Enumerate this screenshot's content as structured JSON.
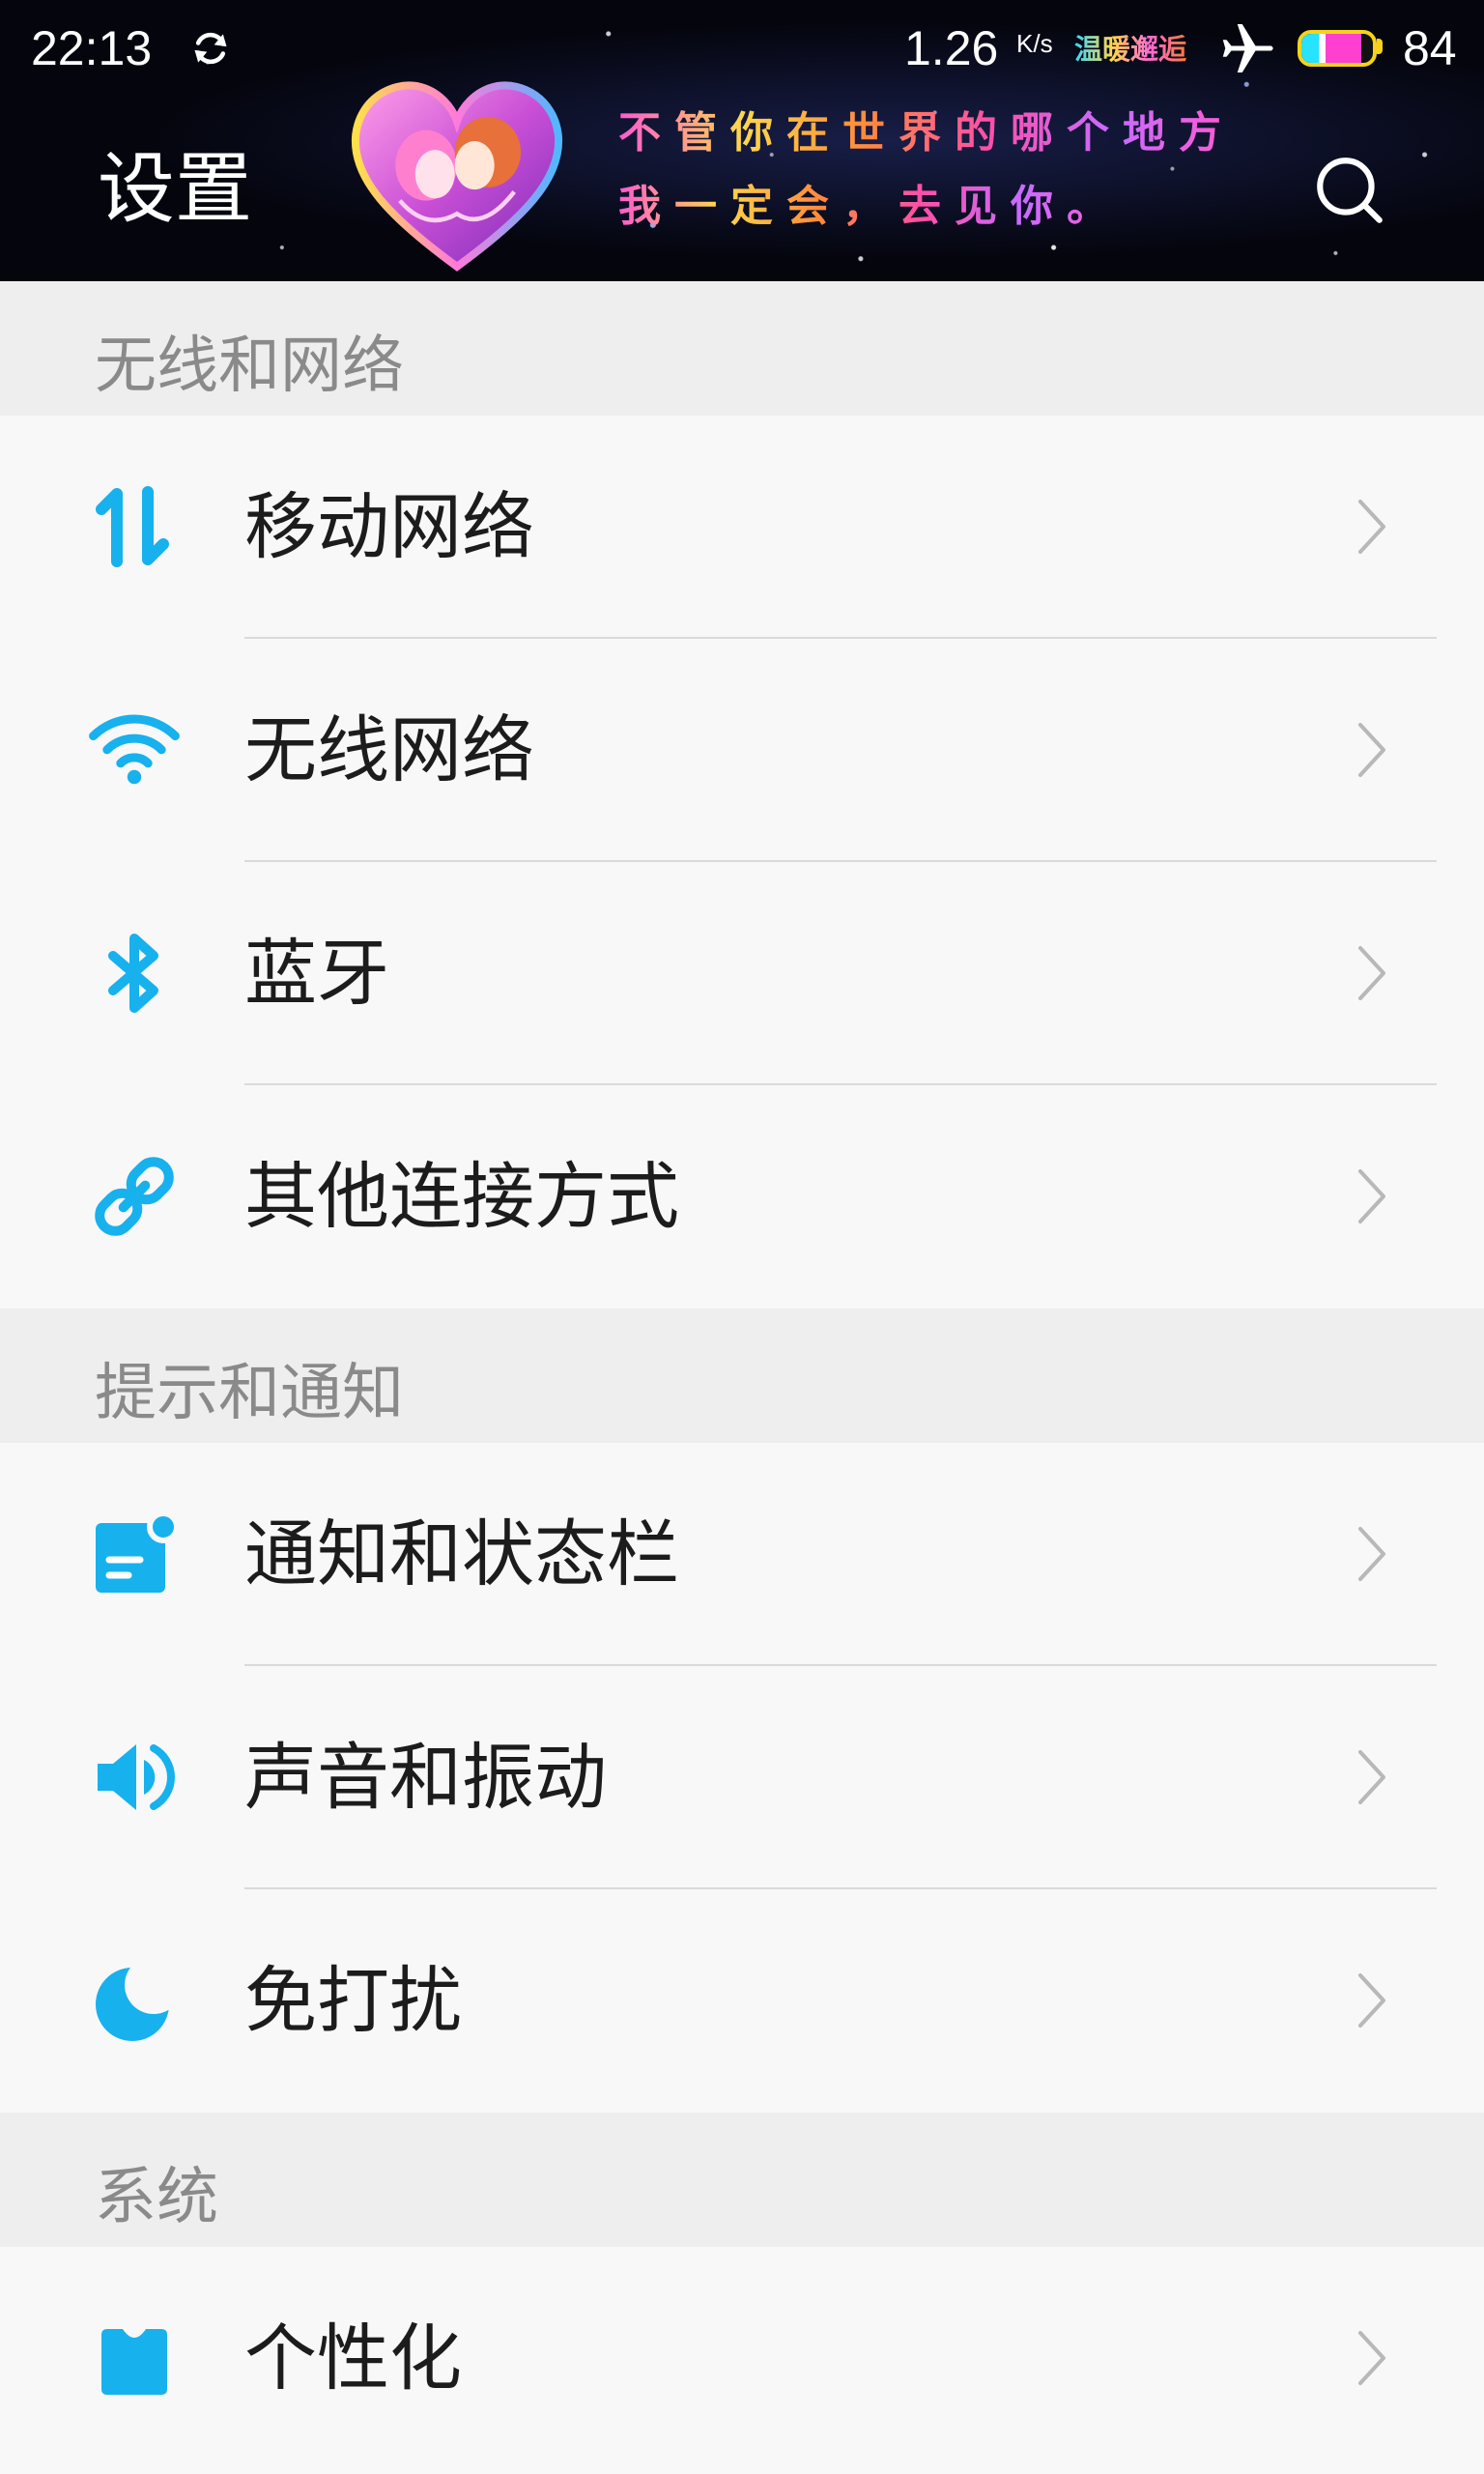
{
  "status_bar": {
    "time": "22:13",
    "net_speed": "1.26",
    "net_speed_unit": "K/s",
    "theme_tag": "温暖邂逅",
    "battery_level": "84"
  },
  "header": {
    "title": "设置",
    "banner_line_1": "不管你在世界的哪个地方",
    "banner_line_2": "我一定会，去见你。"
  },
  "sections": [
    {
      "title": "无线和网络",
      "items": [
        {
          "label": "移动网络",
          "icon": "mobile-data-icon"
        },
        {
          "label": "无线网络",
          "icon": "wifi-icon"
        },
        {
          "label": "蓝牙",
          "icon": "bluetooth-icon"
        },
        {
          "label": "其他连接方式",
          "icon": "link-icon"
        }
      ]
    },
    {
      "title": "提示和通知",
      "items": [
        {
          "label": "通知和状态栏",
          "icon": "notification-icon"
        },
        {
          "label": "声音和振动",
          "icon": "sound-icon"
        },
        {
          "label": "免打扰",
          "icon": "moon-icon"
        }
      ]
    },
    {
      "title": "系统",
      "items": [
        {
          "label": "个性化",
          "icon": "personalization-icon"
        }
      ]
    }
  ],
  "colors": {
    "accent": "#17b1ee",
    "header_bg": "#04050d",
    "row_bg": "#f8f8f8",
    "section_bg": "#eeeeee",
    "divider": "#dadada",
    "chevron": "#b8b8b8",
    "label": "#1c1c1c",
    "section_label": "#8a8a8a"
  }
}
